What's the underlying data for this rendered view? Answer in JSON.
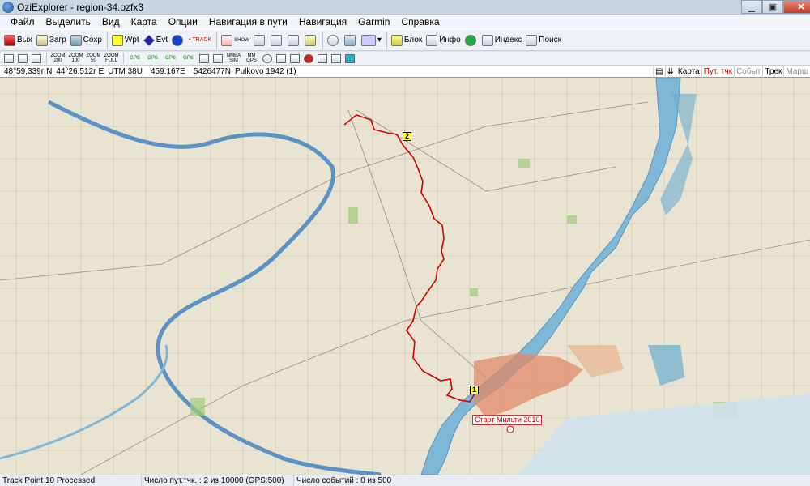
{
  "window": {
    "title": "OziExplorer - region-34.ozfx3"
  },
  "menu": [
    "Файл",
    "Выделить",
    "Вид",
    "Карта",
    "Опции",
    "Навигация в пути",
    "Навигация",
    "Garmin",
    "Справка"
  ],
  "toolbar": {
    "exit": "Вых",
    "load": "Загр",
    "save": "Сохр",
    "block": "Блок",
    "info": "Инфо",
    "index": "Индекс",
    "search": "Поиск",
    "wpt": "Wpt",
    "evt": "Evt",
    "track": "• TRACK",
    "show": "SHOW",
    "zoom": [
      "ZOOM 200",
      "ZOOM 100",
      "ZOOM 50",
      "ZOOM FULL"
    ],
    "gps": [
      "GPS",
      "GPS",
      "GPS",
      "GPS"
    ],
    "nmea": "NMEA SIM",
    "mm": "MM GPS"
  },
  "infobar": {
    "lat": "48°59,339г N",
    "lon": "44°26,512г E",
    "utm": "UTM 38U",
    "easting": "459.167E",
    "northing": "5426477N",
    "datum": "Pulkovo 1942 (1)",
    "tabs": [
      "Карта",
      "Пут. тчк",
      "Событ",
      "Трек",
      "Марш"
    ]
  },
  "map": {
    "waypoints": [
      {
        "id": "1"
      },
      {
        "id": "2"
      }
    ],
    "event_label": "Старт Мильти 2010",
    "colors": {
      "track": "#d40000",
      "water": "#8fc3dc",
      "river": "#5a93c3",
      "city": "#e08a6a",
      "forest": "#9ccc7a"
    }
  },
  "status": {
    "message": "Track Point 10 Processed",
    "waypoints": "Число пут.тчк. : 2 из 10000  (GPS:500)",
    "events": "Число событий : 0 из 500"
  }
}
